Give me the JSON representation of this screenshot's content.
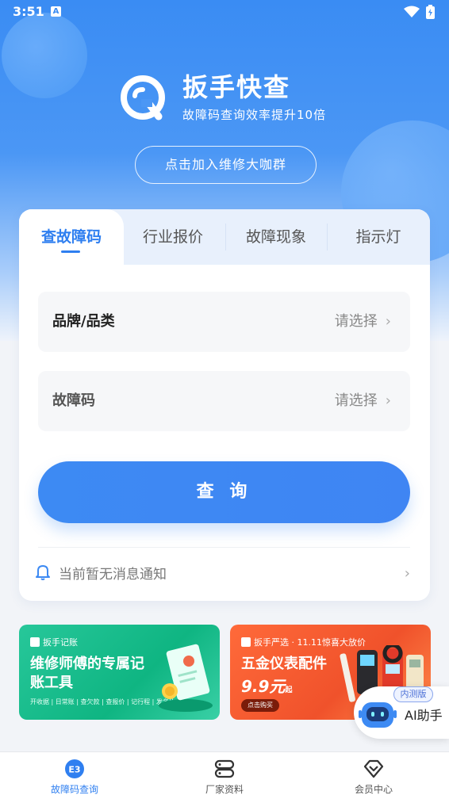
{
  "status": {
    "time": "3:51",
    "notif_letter": "A"
  },
  "hero": {
    "app_name": "扳手快查",
    "slogan": "故障码查询效率提升10倍",
    "join_button": "点击加入维修大咖群"
  },
  "tabs": [
    {
      "label": "查故障码",
      "active": true
    },
    {
      "label": "行业报价",
      "active": false
    },
    {
      "label": "故障现象",
      "active": false
    },
    {
      "label": "指示灯",
      "active": false
    }
  ],
  "fields": {
    "brand": {
      "label": "品牌/品类",
      "value": "请选择"
    },
    "code": {
      "label": "故障码",
      "value": "请选择"
    }
  },
  "query_button": "查 询",
  "notice": "当前暂无消息通知",
  "banners": {
    "green": {
      "tag": "扳手记账",
      "title": "维修师傅的专属记账工具",
      "sub": "开收据 | 日常账 | 查欠款 | 查报价 | 记行程 | 发名片"
    },
    "orange": {
      "tag": "扳手严选 · 11.11惊喜大放价",
      "title": "五金仪表配件",
      "price": "9.9元",
      "price_suffix": "起",
      "buy": "点击购买"
    }
  },
  "ai": {
    "label": "AI助手",
    "badge": "内测版"
  },
  "bottom_nav": [
    {
      "label": "故障码查询",
      "active": true,
      "icon_text": "E3"
    },
    {
      "label": "厂家资料",
      "active": false
    },
    {
      "label": "会员中心",
      "active": false
    }
  ],
  "colors": {
    "primary": "#2f7ff0",
    "hero_top": "#3a8cf3",
    "green_banner": "#18bd8b",
    "orange_banner": "#f4582e"
  }
}
